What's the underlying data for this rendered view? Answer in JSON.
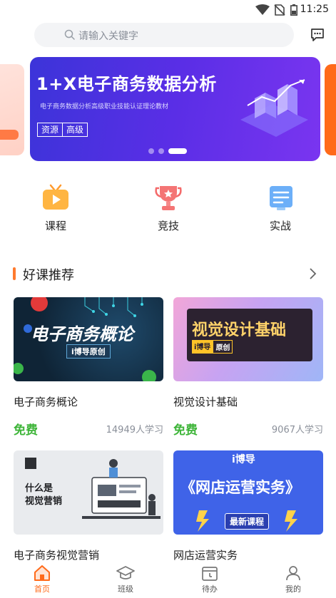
{
  "status_bar": {
    "time": "11:25"
  },
  "search": {
    "placeholder": "请输入关键字"
  },
  "banner": {
    "title": "1+X电子商务数据分析",
    "subtitle": "电子商务数据分析高级职业技能认证理论教材",
    "tags": [
      "资源",
      "高级"
    ],
    "slide_count": 3,
    "active_slide": 3
  },
  "quick_nav": [
    {
      "label": "课程",
      "icon": "tv-icon"
    },
    {
      "label": "竞技",
      "icon": "trophy-icon"
    },
    {
      "label": "实战",
      "icon": "document-icon"
    }
  ],
  "section": {
    "title": "好课推荐"
  },
  "courses": [
    {
      "name": "电子商务概论",
      "price": "免费",
      "learners": "14949人学习",
      "thumb_title": "电子商务概论",
      "thumb_badge": "i博导原创"
    },
    {
      "name": "视觉设计基础",
      "price": "免费",
      "learners": "9067人学习",
      "thumb_title": "视觉设计基础",
      "thumb_badge_brand": "i博导",
      "thumb_badge_tag": "原创"
    },
    {
      "name": "电子商务视觉营销",
      "thumb_title": "什么是\n视觉营销",
      "thumb_line1": "什么是",
      "thumb_line2": "视觉营销"
    },
    {
      "name": "网店运营实务",
      "thumb_title": "《网店运营实务》",
      "thumb_badge": "最新课程",
      "thumb_logo": "i博导"
    }
  ],
  "tab_bar": [
    {
      "label": "首页",
      "icon": "home-icon",
      "active": true
    },
    {
      "label": "班级",
      "icon": "graduation-cap-icon",
      "active": false
    },
    {
      "label": "待办",
      "icon": "calendar-icon",
      "active": false
    },
    {
      "label": "我的",
      "icon": "user-icon",
      "active": false
    }
  ],
  "colors": {
    "accent": "#ff6a1a",
    "free_green": "#3fb53a",
    "section_bar": "#ff7a2e",
    "banner_start": "#3c34d9",
    "banner_end": "#7a35f0"
  }
}
